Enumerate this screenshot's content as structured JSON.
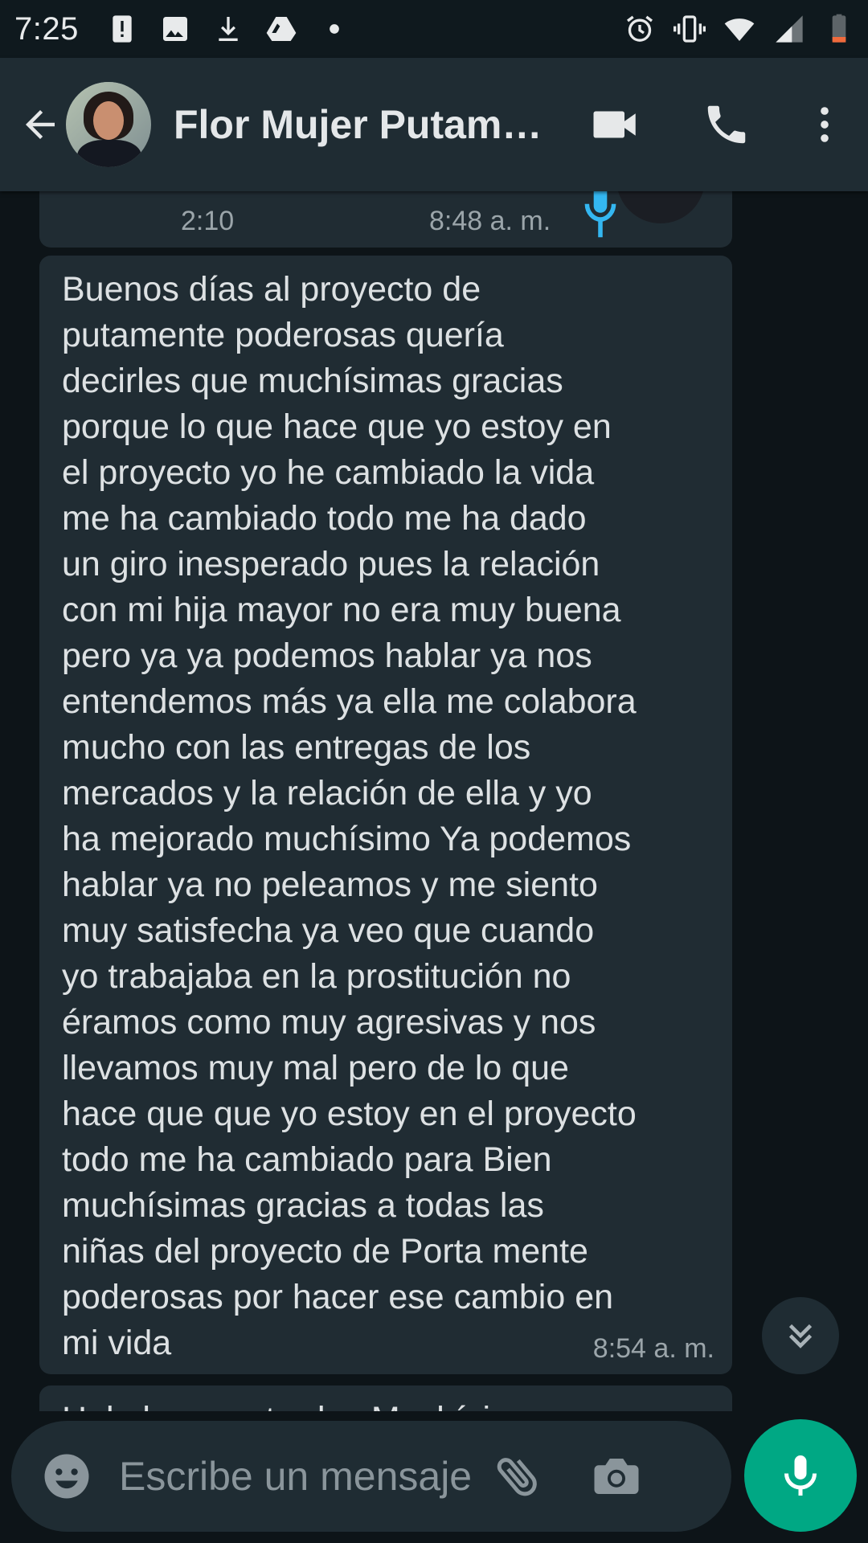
{
  "status_bar": {
    "time": "7:25",
    "icons_left": [
      "alert-icon",
      "image-icon",
      "download-icon",
      "drive-icon",
      "dot-icon"
    ],
    "icons_right": [
      "alarm-icon",
      "vibrate-icon",
      "wifi-icon",
      "signal-icon",
      "battery-icon"
    ]
  },
  "header": {
    "contact_name": "Flor Mujer Putam…",
    "icons": [
      "back-arrow-icon",
      "video-call-icon",
      "phone-icon",
      "more-vert-icon"
    ]
  },
  "messages": {
    "voice_note": {
      "duration": "2:10",
      "time": "8:48 a. m.",
      "mic_color": "#34b7f1"
    },
    "text_message": {
      "text": "Buenos días al proyecto de\nputamente poderosas quería\ndecirles que muchísimas gracias\nporque lo que hace que yo estoy en\nel proyecto yo he cambiado la vida\nme ha cambiado todo me ha dado\nun giro inesperado pues la relación\ncon mi hija mayor no era muy buena\npero ya ya podemos hablar ya nos\nentendemos más ya ella me colabora\nmucho con las entregas de los\nmercados y la relación de ella y yo\nha mejorado muchísimo Ya podemos\nhablar ya no peleamos y me siento\nmuy satisfecha ya veo que cuando\nyo trabajaba en la prostitución no\néramos como muy agresivas y nos\nllevamos muy mal pero de lo que\nhace que que yo estoy en el proyecto\ntodo me ha cambiado para Bien\nmuchísimas gracias a todas las\nniñas del proyecto de Porta mente\npoderosas por hacer ese cambio en\nmi vida",
      "time": "8:54 a. m."
    },
    "next_message_partial": "Hola buenas tardes Muchísimas"
  },
  "input": {
    "placeholder": "Escribe un mensaje"
  },
  "colors": {
    "background": "#0d1418",
    "bubble": "#202c33",
    "header": "#1f2c33",
    "accent": "#00a884"
  }
}
